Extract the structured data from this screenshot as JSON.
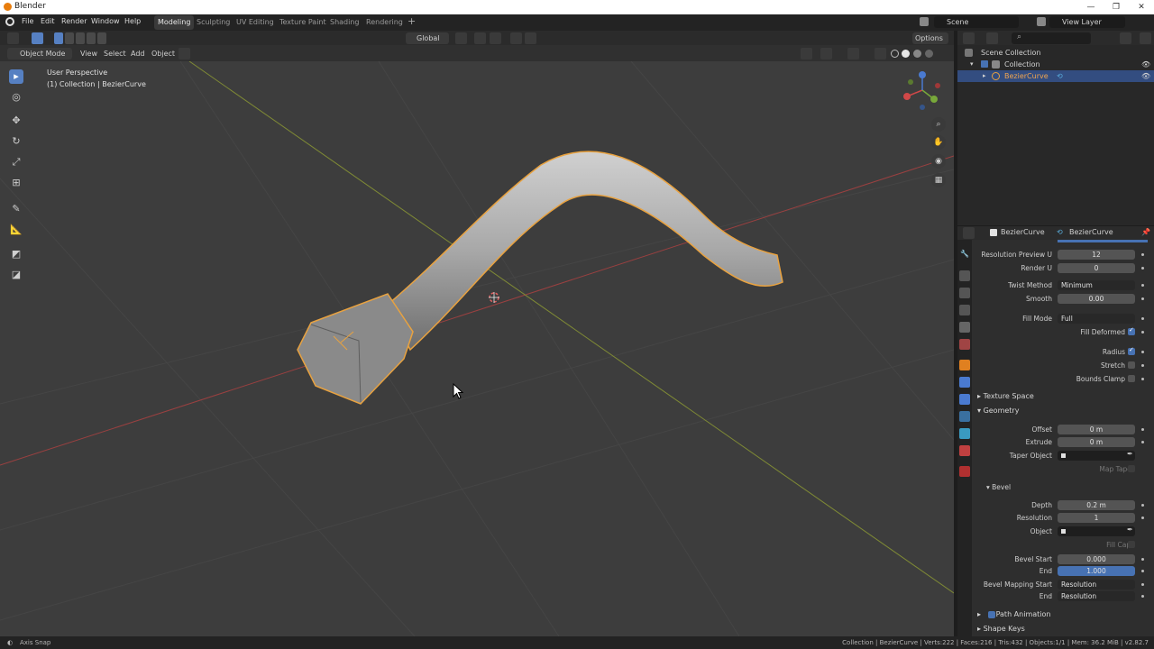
{
  "window": {
    "title": "Blender",
    "controls": [
      "—",
      "❐",
      "✕"
    ]
  },
  "menu": [
    "File",
    "Edit",
    "Render",
    "Window",
    "Help"
  ],
  "workspaces": [
    {
      "label": "Modeling",
      "active": true
    },
    {
      "label": "Sculpting",
      "active": false
    },
    {
      "label": "UV Editing",
      "active": false
    },
    {
      "label": "Texture Paint",
      "active": false
    },
    {
      "label": "Shading",
      "active": false
    },
    {
      "label": "Rendering",
      "active": false
    }
  ],
  "scene_field": "Scene",
  "view_layer_field": "View Layer",
  "header3d": {
    "orientation": "Global",
    "options": "Options"
  },
  "header3d_row2": {
    "mode": "Object Mode",
    "menus": [
      "View",
      "Select",
      "Add",
      "Object"
    ]
  },
  "viewport": {
    "overlay_line1": "User Perspective",
    "overlay_line2": "(1) Collection | BezierCurve"
  },
  "navgizmo": {
    "x": "X",
    "y": "Y",
    "z": "Z"
  },
  "outliner": {
    "rows": [
      {
        "label": "Scene Collection",
        "selected": false
      },
      {
        "label": "Collection",
        "selected": false
      },
      {
        "label": "BezierCurve",
        "selected": true
      }
    ]
  },
  "props_header": {
    "object": "BezierCurve",
    "data": "BezierCurve"
  },
  "props": {
    "resolution_preview_u": {
      "label": "Resolution Preview U",
      "value": "12"
    },
    "render_u": {
      "label": "Render U",
      "value": "0"
    },
    "twist_method": {
      "label": "Twist Method",
      "value": "Minimum"
    },
    "smooth": {
      "label": "Smooth",
      "value": "0.00"
    },
    "fill_mode": {
      "label": "Fill Mode",
      "value": "Full"
    },
    "fill_deformed": {
      "label": "Fill Deformed",
      "checked": true
    },
    "radius": {
      "label": "Radius",
      "checked": true
    },
    "stretch": {
      "label": "Stretch",
      "checked": false
    },
    "bounds_clamp": {
      "label": "Bounds Clamp",
      "checked": false
    },
    "texture_space": "Texture Space",
    "geometry": "Geometry",
    "offset": {
      "label": "Offset",
      "value": "0 m"
    },
    "extrude": {
      "label": "Extrude",
      "value": "0 m"
    },
    "taper_object": {
      "label": "Taper Object",
      "value": ""
    },
    "map_taper": {
      "label": "Map Taper",
      "checked": false
    },
    "bevel": "Bevel",
    "depth": {
      "label": "Depth",
      "value": "0.2 m"
    },
    "resolution": {
      "label": "Resolution",
      "value": "1"
    },
    "object": {
      "label": "Object",
      "value": ""
    },
    "fill_caps": {
      "label": "Fill Caps",
      "checked": false
    },
    "bevel_start": {
      "label": "Bevel Start",
      "value": "0.000"
    },
    "end": {
      "label": "End",
      "value": "1.000"
    },
    "bevel_mapping_start": {
      "label": "Bevel Mapping Start",
      "value": "Resolution"
    },
    "mapping_end": {
      "label": "End",
      "value": "Resolution"
    },
    "path_animation": "Path Animation",
    "shape_keys": "Shape Keys"
  },
  "status": {
    "left": "Axis Snap",
    "right": "Collection | BezierCurve | Verts:222 | Faces:216 | Tris:432 | Objects:1/1 | Mem: 36.2 MiB | v2.82.7"
  },
  "colors": {
    "accent": "#4772b3",
    "selection_outline": "#e8a240",
    "x_axis": "#b34a4a",
    "y_axis": "#8a9a3a"
  }
}
